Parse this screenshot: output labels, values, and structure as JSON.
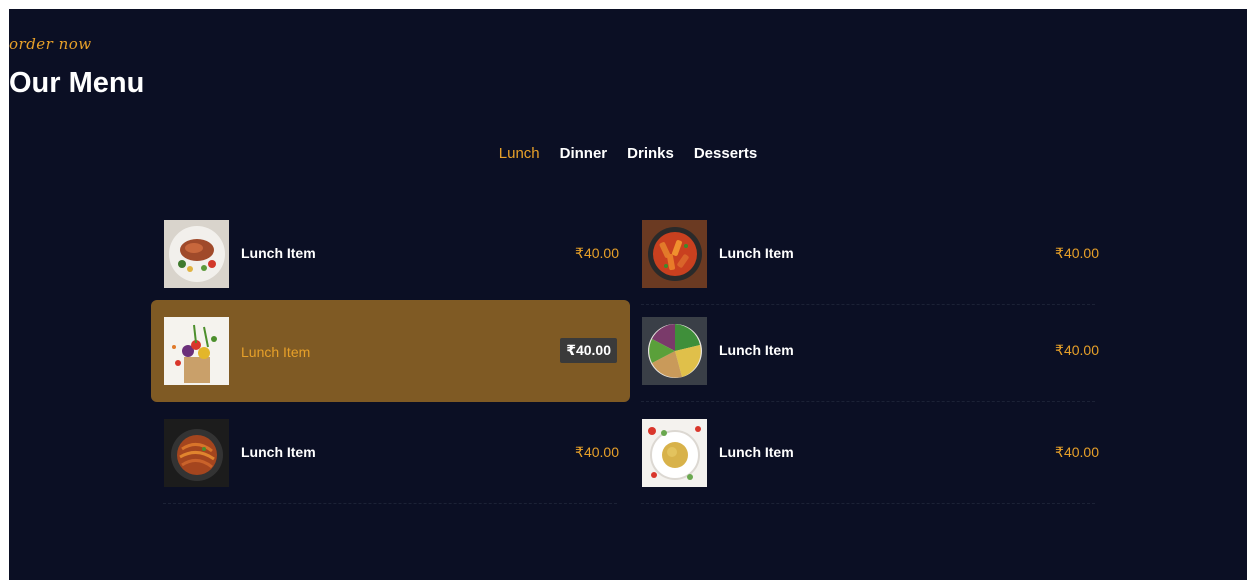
{
  "header": {
    "kicker": "order now",
    "title": "Our Menu"
  },
  "tabs": [
    {
      "label": "Lunch",
      "active": true
    },
    {
      "label": "Dinner",
      "active": false
    },
    {
      "label": "Drinks",
      "active": false
    },
    {
      "label": "Desserts",
      "active": false
    }
  ],
  "items": [
    {
      "name": "Lunch Item",
      "price": "₹40.00",
      "image": "grilled-steak-plate",
      "highlighted": false
    },
    {
      "name": "Lunch Item",
      "price": "₹40.00",
      "image": "penne-pasta-pan",
      "highlighted": false
    },
    {
      "name": "Lunch Item",
      "price": "₹40.00",
      "image": "vegetable-bag",
      "highlighted": true
    },
    {
      "name": "Lunch Item",
      "price": "₹40.00",
      "image": "salad-bowl",
      "highlighted": false
    },
    {
      "name": "Lunch Item",
      "price": "₹40.00",
      "image": "noodles-bowl",
      "highlighted": false
    },
    {
      "name": "Lunch Item",
      "price": "₹40.00",
      "image": "rice-plate",
      "highlighted": false
    }
  ],
  "colors": {
    "background": "#0b0f24",
    "accent": "#e7a029",
    "highlight": "#7f5a24"
  }
}
